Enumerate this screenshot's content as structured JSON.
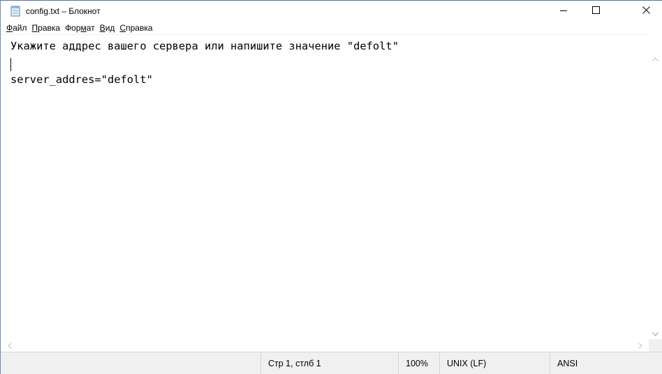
{
  "window": {
    "title": "config.txt – Блокнот",
    "minimize_icon": "minimize-icon",
    "maximize_icon": "maximize-icon",
    "close_icon": "close-icon"
  },
  "menu": {
    "items": [
      {
        "accel": "Ф",
        "rest": "айл"
      },
      {
        "accel": "П",
        "rest": "равка"
      },
      {
        "pre": "Фор",
        "accel": "м",
        "rest": "ат"
      },
      {
        "accel": "В",
        "rest": "ид"
      },
      {
        "accel": "С",
        "rest": "правка"
      }
    ]
  },
  "editor": {
    "content": "Укажите аддрес вашего сервера или напишите значение \"defolt\"\n\nserver_addres=\"defolt\""
  },
  "status": {
    "position": "Стр 1, стлб 1",
    "zoom": "100%",
    "line_ending": "UNIX (LF)",
    "encoding": "ANSI"
  },
  "colors": {
    "accent_border": "#4a78b6",
    "statusbar_bg": "#f0f0f0"
  }
}
